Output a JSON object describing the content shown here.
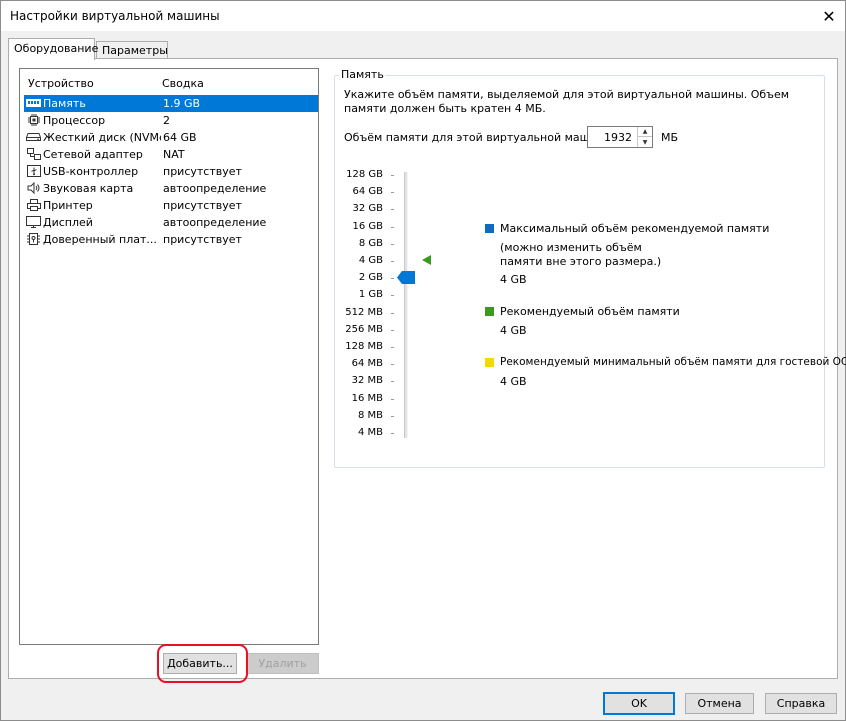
{
  "window": {
    "title": "Настройки виртуальной машины",
    "close_glyph": "✕"
  },
  "tabs": [
    {
      "label": "Оборудование",
      "active": true
    },
    {
      "label": "Параметры",
      "active": false
    }
  ],
  "device_list": {
    "col_device": "Устройство",
    "col_summary": "Сводка",
    "items": [
      {
        "icon": "memory-icon",
        "name": "Память",
        "summary": "1.9 GB",
        "selected": true
      },
      {
        "icon": "processor-icon",
        "name": "Процессор",
        "summary": "2"
      },
      {
        "icon": "hard-disk-icon",
        "name": "Жесткий диск (NVMe)",
        "summary": "64 GB"
      },
      {
        "icon": "network-adapter-icon",
        "name": "Сетевой адаптер",
        "summary": "NAT"
      },
      {
        "icon": "usb-icon",
        "name": "USB-контроллер",
        "summary": "присутствует"
      },
      {
        "icon": "speaker-icon",
        "name": "Звуковая карта",
        "summary": "автоопределение"
      },
      {
        "icon": "printer-icon",
        "name": "Принтер",
        "summary": "присутствует"
      },
      {
        "icon": "display-icon",
        "name": "Дисплей",
        "summary": "автоопределение"
      },
      {
        "icon": "tpm-icon",
        "name": "Доверенный плат...",
        "summary": "присутствует"
      }
    ]
  },
  "buttons": {
    "add": "Добавить...",
    "remove": "Удалить",
    "ok": "OK",
    "cancel": "Отмена",
    "help": "Справка"
  },
  "memory": {
    "group_title": "Память",
    "description": "Укажите объём памяти, выделяемой для этой виртуальной машины. Объем памяти должен быть кратен 4 МБ.",
    "field_label": "Объём памяти для этой виртуальной машины:",
    "value": "1932",
    "unit": "МБ",
    "scale": [
      "128 GB",
      "64 GB",
      "32 GB",
      "16 GB",
      "8 GB",
      "4 GB",
      "2 GB",
      "1 GB",
      "512 MB",
      "256 MB",
      "128 MB",
      "64 MB",
      "32 MB",
      "16 MB",
      "8 MB",
      "4 MB"
    ],
    "slider_level": "2 GB",
    "recommended_marker_level": "4 GB",
    "legend": {
      "max_title": "Максимальный объём рекомендуемой памяти",
      "max_note": "(можно изменить объём памяти вне этого размера.)",
      "max_value": "4 GB",
      "rec_title": "Рекомендуемый объём памяти",
      "rec_value": "4 GB",
      "min_title": "Рекомендуемый минимальный объём памяти для гостевой ОС",
      "min_value": "4 GB"
    },
    "colors": {
      "max": "#0f6cbd",
      "rec": "#3a9a1e",
      "min": "#f5d800"
    }
  }
}
